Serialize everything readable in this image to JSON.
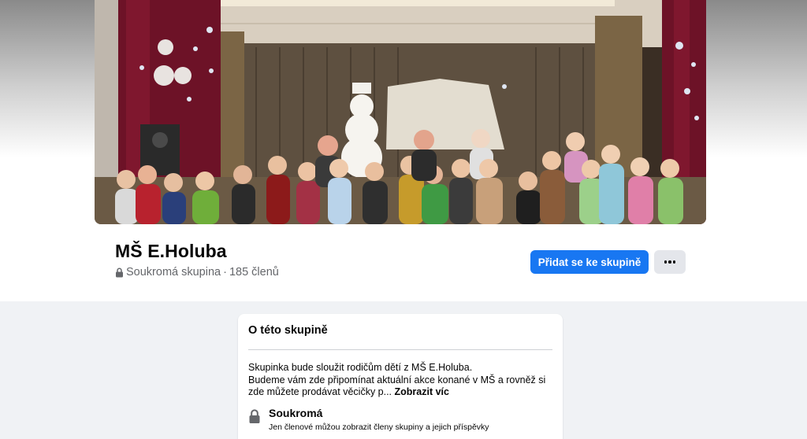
{
  "group": {
    "name": "MŠ E.Holuba",
    "privacy_label": "Soukromá skupina",
    "separator": " · ",
    "member_count": "185 členů"
  },
  "actions": {
    "join_label": "Přidat se ke skupině",
    "more_icon": "more-horizontal-icon"
  },
  "about": {
    "title": "O této skupině",
    "description_line1": "Skupinka bude sloužit rodičům dětí z MŠ E.Holuba.",
    "description_line2": "Budeme vám zde připomínat aktuální akce konané v MŠ a rovněž si zde můžete prodávat věcičky p...",
    "see_more": "Zobrazit víc",
    "privacy_title": "Soukromá",
    "privacy_desc": "Jen členové můžou zobrazit členy skupiny a jejich příspěvky",
    "privacy_icon": "lock-icon"
  },
  "colors": {
    "primary": "#1877f2",
    "text_secondary": "#65676b",
    "page_bg": "#f0f2f5"
  }
}
